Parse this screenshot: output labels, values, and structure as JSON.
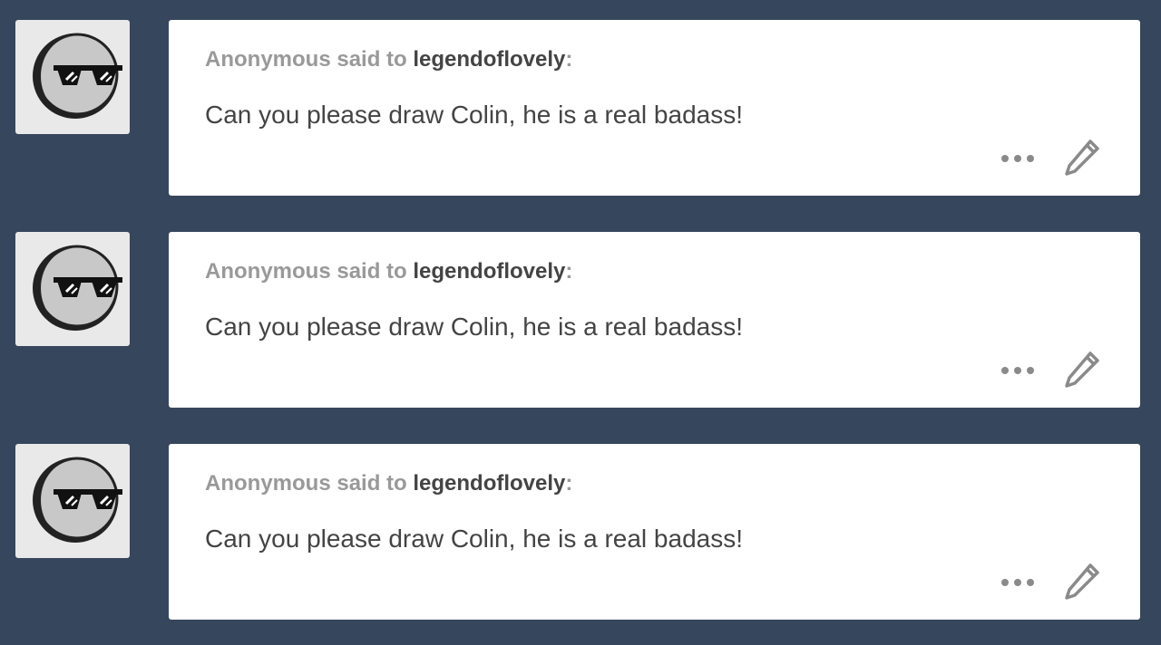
{
  "asks": [
    {
      "asker": "Anonymous",
      "said_to": " said to ",
      "blog": "legendoflovely",
      "colon": ":",
      "question": "Can you please draw Colin, he is a real badass!",
      "avatar_icon": "anonymous-sunglasses-avatar",
      "more_icon": "ellipsis-icon",
      "edit_icon": "pencil-icon"
    },
    {
      "asker": "Anonymous",
      "said_to": " said to ",
      "blog": "legendoflovely",
      "colon": ":",
      "question": "Can you please draw Colin, he is a real badass!",
      "avatar_icon": "anonymous-sunglasses-avatar",
      "more_icon": "ellipsis-icon",
      "edit_icon": "pencil-icon"
    },
    {
      "asker": "Anonymous",
      "said_to": " said to ",
      "blog": "legendoflovely",
      "colon": ":",
      "question": "Can you please draw Colin, he is a real badass!",
      "avatar_icon": "anonymous-sunglasses-avatar",
      "more_icon": "ellipsis-icon",
      "edit_icon": "pencil-icon"
    }
  ],
  "colors": {
    "background": "#36465d",
    "card": "#ffffff",
    "muted_text": "#999999",
    "body_text": "#444444",
    "icon": "#8a8a8a"
  }
}
